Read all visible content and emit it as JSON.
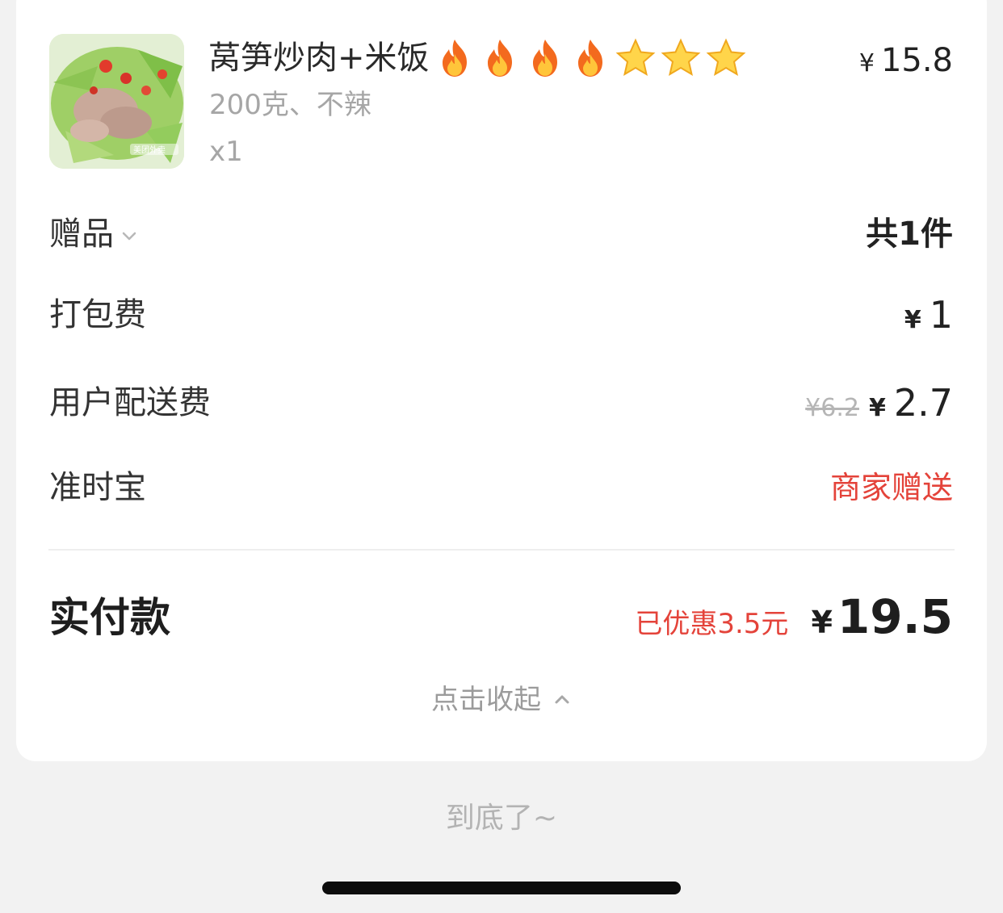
{
  "item": {
    "name": "莴笋炒肉+米饭",
    "badges": [
      "fire-icon",
      "fire-icon",
      "fire-icon",
      "fire-icon",
      "star-icon",
      "star-icon",
      "star-icon"
    ],
    "price_symbol": "¥",
    "price": "15.8",
    "spec": "200克、不辣",
    "quantity": "x1",
    "thumbnail_watermark": "美团外卖"
  },
  "rows": {
    "gift": {
      "label": "赠品",
      "value": "共1件"
    },
    "packing": {
      "label": "打包费",
      "symbol": "¥",
      "value": "1"
    },
    "delivery": {
      "label": "用户配送费",
      "original": "¥6.2",
      "symbol": "¥",
      "value": "2.7"
    },
    "ontime": {
      "label": "准时宝",
      "value": "商家赠送"
    }
  },
  "total": {
    "label": "实付款",
    "saved": "已优惠3.5元",
    "symbol": "¥",
    "amount": "19.5"
  },
  "collapse_label": "点击收起",
  "bottom_note": "到底了~",
  "colors": {
    "accent_red": "#e4433a",
    "page_bg": "#f2f2f2",
    "card_bg": "#ffffff"
  }
}
